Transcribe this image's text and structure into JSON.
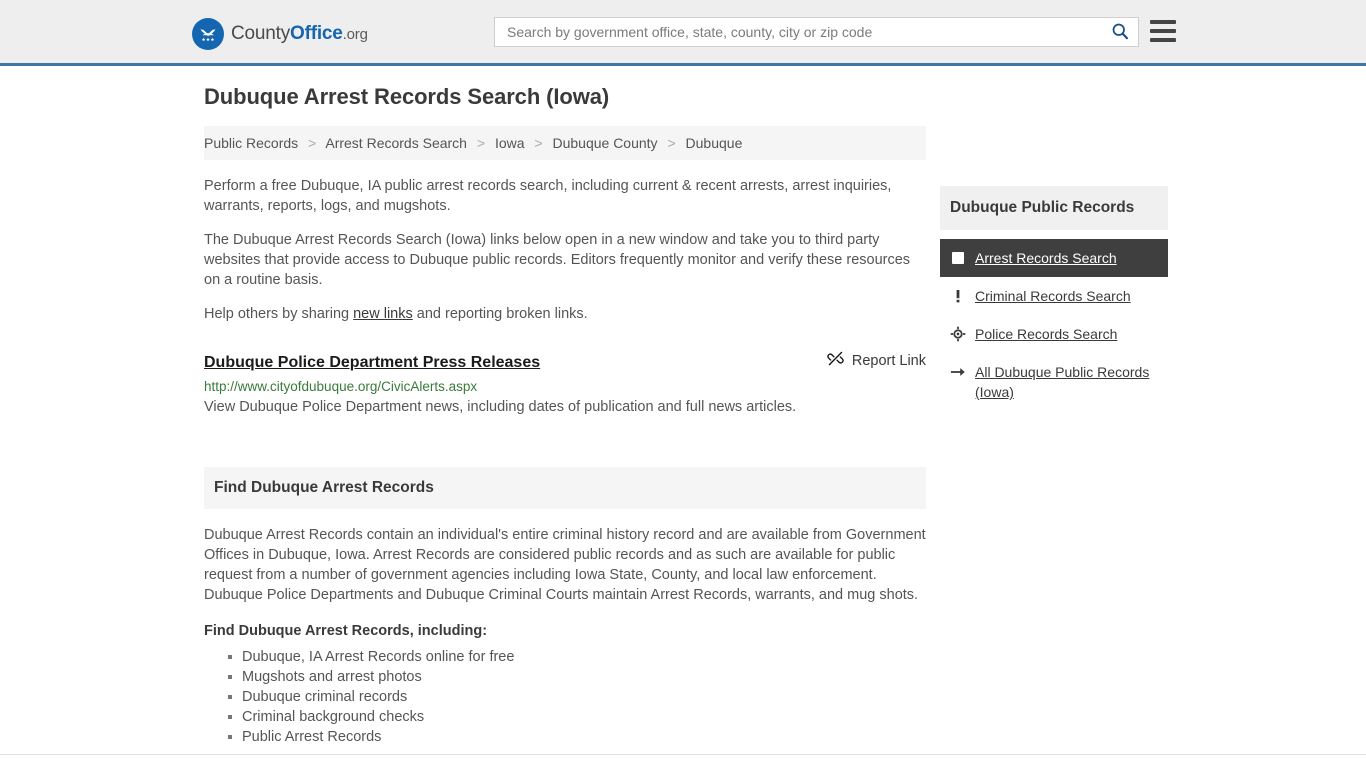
{
  "header": {
    "logo_text_1": "County",
    "logo_text_2": "Office",
    "logo_text_3": ".org",
    "logo_icon": "eagle-emblem-icon",
    "search": {
      "placeholder": "Search by government office, state, county, city or zip code",
      "value": "",
      "search_icon": "search-icon"
    },
    "menu_icon": "hamburger-menu-icon",
    "accent_color": "#3c77a8"
  },
  "main": {
    "title": "Dubuque Arrest Records Search (Iowa)",
    "breadcrumb": [
      "Public Records",
      "Arrest Records Search",
      "Iowa",
      "Dubuque County",
      "Dubuque"
    ],
    "breadcrumb_separator": ">",
    "paragraphs": [
      "Perform a free Dubuque, IA public arrest records search, including current & recent arrests, arrest inquiries, warrants, reports, logs, and mugshots.",
      "The Dubuque Arrest Records Search (Iowa) links below open in a new window and take you to third party websites that provide access to Dubuque public records. Editors frequently monitor and verify these resources on a routine basis."
    ],
    "help_text_before": "Help others by sharing ",
    "help_link": "new links",
    "help_text_after": " and reporting broken links.",
    "link_entry": {
      "title": "Dubuque Police Department Press Releases",
      "report_label": "Report Link",
      "report_icon": "broken-link-icon",
      "url": "http://www.cityofdubuque.org/CivicAlerts.aspx",
      "description": "View Dubuque Police Department news, including dates of publication and full news articles."
    },
    "section": {
      "heading": "Find Dubuque Arrest Records",
      "paragraph": "Dubuque Arrest Records contain an individual's entire criminal history record and are available from Government Offices in Dubuque, Iowa. Arrest Records are considered public records and as such are available for public request from a number of government agencies including Iowa State, County, and local law enforcement. Dubuque Police Departments and Dubuque Criminal Courts maintain Arrest Records, warrants, and mug shots.",
      "sub_heading": "Find Dubuque Arrest Records, including:",
      "bullets": [
        "Dubuque, IA Arrest Records online for free",
        "Mugshots and arrest photos",
        "Dubuque criminal records",
        "Criminal background checks",
        "Public Arrest Records"
      ]
    }
  },
  "sidebar": {
    "heading": "Dubuque Public Records",
    "items": [
      {
        "label": "Arrest Records Search",
        "icon": "white-square-icon",
        "active": true
      },
      {
        "label": "Criminal Records Search",
        "icon": "exclamation-icon",
        "active": false
      },
      {
        "label": "Police Records Search",
        "icon": "crosshair-target-icon",
        "active": false
      },
      {
        "label": "All Dubuque Public Records (Iowa)",
        "icon": "arrow-right-icon",
        "active": false
      }
    ]
  }
}
